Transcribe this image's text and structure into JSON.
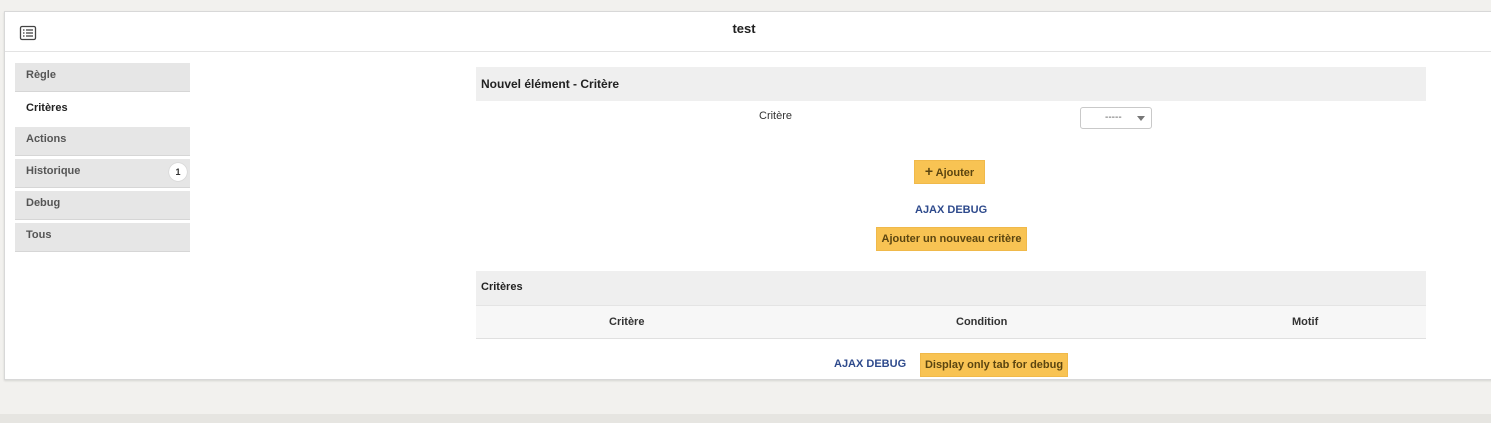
{
  "header": {
    "title": "test",
    "icon": "list-icon"
  },
  "tabs": [
    {
      "label": "Règle",
      "active": false
    },
    {
      "label": "Critères",
      "active": true
    },
    {
      "label": "Actions",
      "active": false
    },
    {
      "label": "Historique",
      "active": false,
      "badge": "1"
    },
    {
      "label": "Debug",
      "active": false
    },
    {
      "label": "Tous",
      "active": false
    }
  ],
  "new_item": {
    "title": "Nouvel élément - Critère",
    "field_label": "Critère",
    "select_value": "-----",
    "add_button": "Ajouter",
    "debug_link": "AJAX DEBUG",
    "new_criterion_button": "Ajouter un nouveau critère"
  },
  "criteria": {
    "title": "Critères",
    "columns": [
      "Critère",
      "Condition",
      "Motif"
    ],
    "debug_link": "AJAX DEBUG",
    "debug_button": "Display only tab for debug"
  },
  "colors": {
    "accent_button": "#f8c353",
    "link": "#2e4a8c"
  }
}
